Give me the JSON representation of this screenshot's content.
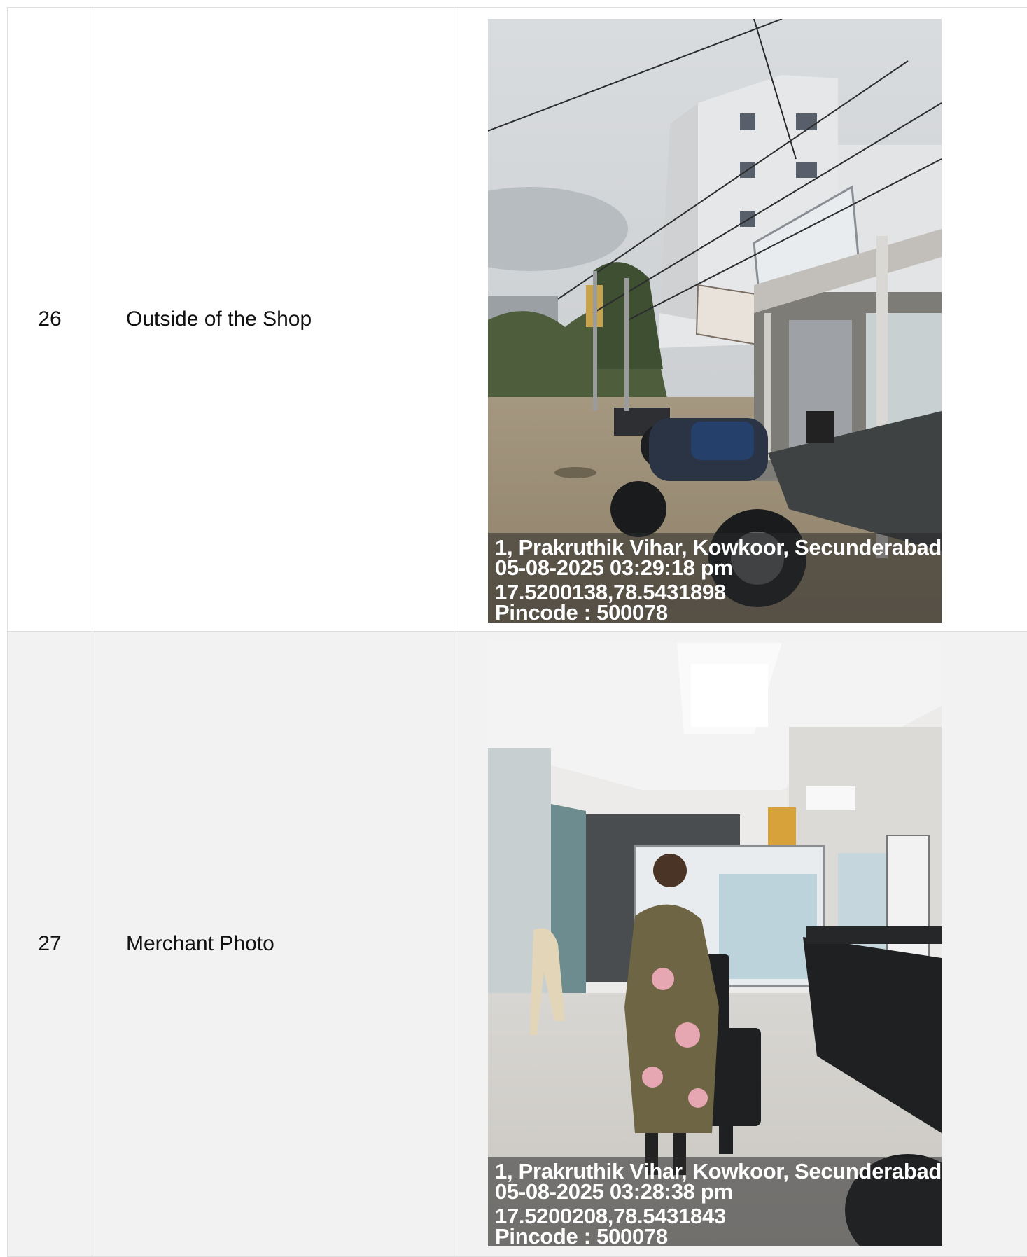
{
  "rows": [
    {
      "number": "26",
      "label": "Outside of the Shop",
      "photo_icon": "storefront-photo",
      "stamp": {
        "address": "1, Prakruthik Vihar, Kowkoor, Secunderabad,",
        "datetime": "05-08-2025 03:29:18 pm",
        "coords": "17.5200138,78.5431898",
        "pincode": "Pincode : 500078"
      }
    },
    {
      "number": "27",
      "label": "Merchant Photo",
      "photo_icon": "merchant-photo",
      "stamp": {
        "address": "1, Prakruthik Vihar, Kowkoor, Secunderabad,",
        "datetime": "05-08-2025 03:28:38 pm",
        "coords": "17.5200208,78.5431843",
        "pincode": "Pincode : 500078"
      }
    }
  ],
  "colors": {
    "border": "#dedede",
    "alt_row": "#f2f2f2",
    "text": "#111111",
    "stamp_text": "#ffffff"
  }
}
